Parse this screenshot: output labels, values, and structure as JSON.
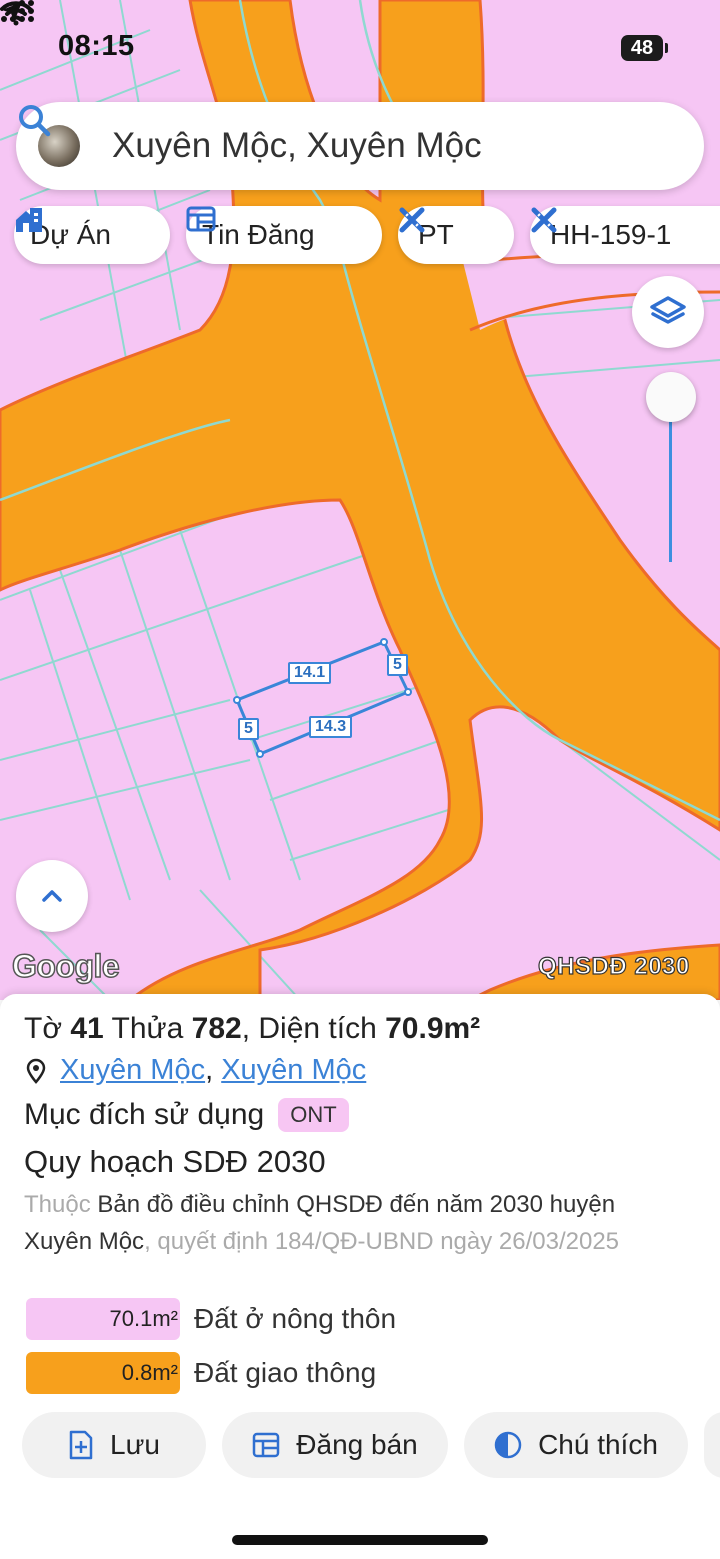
{
  "status_bar": {
    "time": "08:15",
    "battery": "48"
  },
  "search": {
    "text": "Xuyên Mộc, Xuyên Mộc"
  },
  "chips": [
    "Dự Án",
    "Tin Đăng",
    "PT",
    "HH-159-1"
  ],
  "map": {
    "attribution": "Google",
    "layer_label": "QHSDĐ 2030",
    "parcel_edges": {
      "top": "14.1",
      "bottom": "14.3",
      "left": "5",
      "right": "5"
    },
    "colors": {
      "residential": "#f6c6f4",
      "road": "#f7a01c",
      "parcel_line": "#3a86d8",
      "lot_line": "#8fd9d0"
    }
  },
  "info": {
    "title_prefix": "Tờ",
    "sheet_no": "41",
    "parcel_label": "Thửa",
    "parcel_no": "782",
    "area_label": ", Diện tích",
    "area": "70.9m²",
    "location_a": "Xuyên Mộc",
    "location_sep": ",",
    "location_b": "Xuyên Mộc",
    "purpose_label": "Mục đích sử dụng",
    "purpose_code": "ONT",
    "plan_title": "Quy hoạch SDĐ 2030",
    "desc_prefix": "Thuộc",
    "desc_map": "Bản đồ điều chỉnh QHSDĐ đến năm 2030 huyện Xuyên Mộc",
    "desc_decision": ", quyết định 184/QĐ-UBND ngày 26/03/2025",
    "legend": [
      {
        "area": "70.1m²",
        "label": "Đất ở nông thôn",
        "color": "#f6c6f4"
      },
      {
        "area": "0.8m²",
        "label": "Đất giao thông",
        "color": "#f7a01c"
      }
    ]
  },
  "actions": {
    "save": "Lưu",
    "post": "Đăng bán",
    "legend": "Chú thích"
  }
}
